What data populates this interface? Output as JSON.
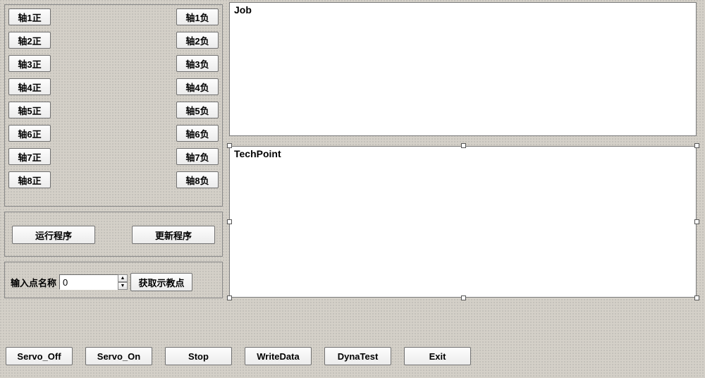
{
  "axis": {
    "positive": [
      "轴1正",
      "轴2正",
      "轴3正",
      "轴4正",
      "轴5正",
      "轴6正",
      "轴7正",
      "轴8正"
    ],
    "negative": [
      "轴1负",
      "轴2负",
      "轴3负",
      "轴4负",
      "轴5负",
      "轴6负",
      "轴7负",
      "轴8负"
    ]
  },
  "program": {
    "run": "运行程序",
    "update": "更新程序"
  },
  "teach": {
    "labelPrefix": "输入点名称",
    "value": "0",
    "getBtn": "获取示教点"
  },
  "panels": {
    "jobLabel": "Job",
    "techPointLabel": "TechPoint"
  },
  "bottom": {
    "servoOff": "Servo_Off",
    "servoOn": "Servo_On",
    "stop": "Stop",
    "writeData": "WriteData",
    "dynaTest": "DynaTest",
    "exit": "Exit"
  }
}
